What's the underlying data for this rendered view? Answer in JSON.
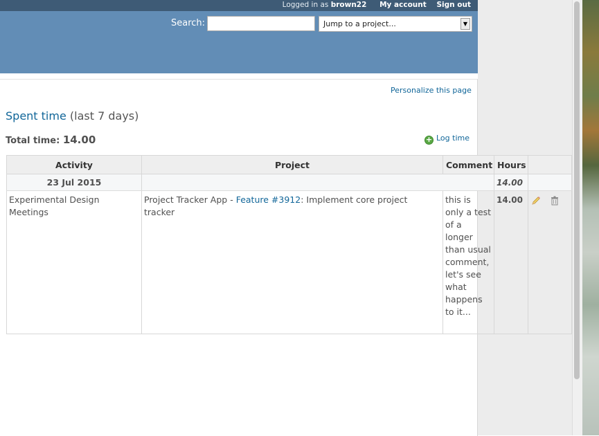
{
  "top_menu": {
    "logged_in_prefix": "Logged in as",
    "username": "brown22",
    "my_account": "My account",
    "sign_out": "Sign out"
  },
  "header": {
    "search_label": "Search:",
    "search_value": "",
    "jump_to_project": "Jump to a project..."
  },
  "page": {
    "personalize": "Personalize this page",
    "title_link": "Spent time",
    "title_suffix": "(last 7 days)",
    "total_label": "Total time:",
    "total_value": "14.00",
    "log_time": "Log time"
  },
  "table": {
    "columns": [
      "Activity",
      "Project",
      "Comment",
      "Hours",
      ""
    ],
    "groups": [
      {
        "date": "23 Jul 2015",
        "hours": "14.00",
        "entries": [
          {
            "activity": "Experimental Design Meetings",
            "project": "Project Tracker App",
            "project_sep": " - ",
            "issue_link": "Feature #3912",
            "issue_title": ": Implement core project tracker",
            "comment": "this is only a test of a longer than usual comment, let's see what happens to it...",
            "hours": "14.00"
          }
        ]
      }
    ]
  },
  "icons": {
    "edit": "pencil-icon",
    "delete": "trash-icon",
    "log_time": "add-icon",
    "dropdown": "chevron-down-icon"
  },
  "colors": {
    "top_menu_bg": "#3e5b76",
    "header_bg": "#628db6",
    "link": "#116699",
    "table_header_bg": "#eeeeee"
  }
}
